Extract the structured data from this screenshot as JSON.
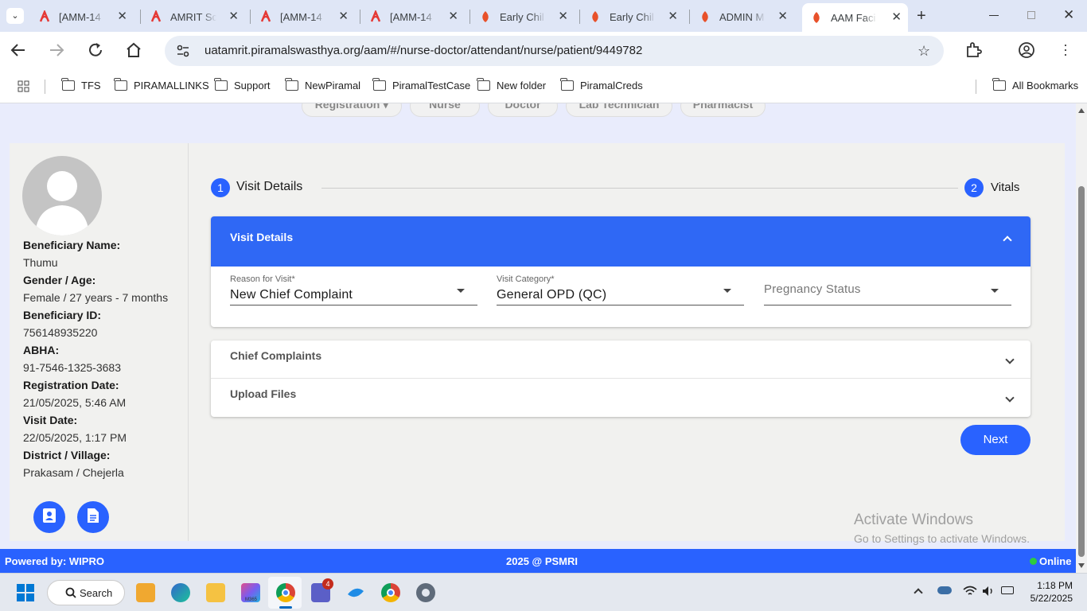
{
  "browser": {
    "tabs": [
      {
        "title": "[AMM-14",
        "active": false
      },
      {
        "title": "AMRIT Sc",
        "active": false
      },
      {
        "title": "[AMM-14",
        "active": false
      },
      {
        "title": "[AMM-14",
        "active": false
      },
      {
        "title": "Early Chil",
        "active": false
      },
      {
        "title": "Early Chil",
        "active": false
      },
      {
        "title": "ADMIN M",
        "active": false
      },
      {
        "title": "AAM Faci",
        "active": true
      }
    ],
    "url": "uatamrit.piramalswasthya.org/aam/#/nurse-doctor/attendant/nurse/patient/9449782",
    "bookmarks": [
      "TFS",
      "PIRAMALLINKS",
      "Support",
      "NewPiramal",
      "PiramalTestCase",
      "New folder",
      "PiramalCreds"
    ],
    "all_bookmarks": "All Bookmarks"
  },
  "roles": [
    "Registration",
    "Nurse",
    "Doctor",
    "Lab Technician",
    "Pharmacist"
  ],
  "beneficiary": {
    "name_label": "Beneficiary Name:",
    "name": "Thumu",
    "gender_label": "Gender / Age:",
    "gender_age": "Female / 27 years - 7 months",
    "id_label": "Beneficiary ID:",
    "id": "756148935220",
    "abha_label": "ABHA:",
    "abha": "91-7546-1325-3683",
    "reg_label": "Registration Date:",
    "reg_date": "21/05/2025, 5:46 AM",
    "visit_label": "Visit Date:",
    "visit_date": "22/05/2025, 1:17 PM",
    "district_label": "District / Village:",
    "district": "Prakasam / Chejerla"
  },
  "stepper": [
    {
      "num": "1",
      "label": "Visit Details"
    },
    {
      "num": "2",
      "label": "Vitals"
    }
  ],
  "visit_panel": {
    "title": "Visit Details",
    "reason_label": "Reason for Visit",
    "reason_value": "New Chief Complaint",
    "category_label": "Visit Category",
    "category_value": "General OPD (QC)",
    "pregnancy_label": "Pregnancy Status"
  },
  "sections": [
    "Chief Complaints",
    "Upload Files"
  ],
  "next_label": "Next",
  "watermark": {
    "line1": "Activate Windows",
    "line2": "Go to Settings to activate Windows."
  },
  "footer": {
    "left": "Powered by: WIPRO",
    "center": "2025 @ PSMRI",
    "right": "Online"
  },
  "taskbar": {
    "search": "Search",
    "time": "1:18 PM",
    "date": "5/22/2025",
    "teams_badge": "4",
    "m365_label": "M365"
  },
  "colors": {
    "primary": "#2962ff",
    "header_blue": "#2f68f5",
    "online": "#2ecc40"
  }
}
